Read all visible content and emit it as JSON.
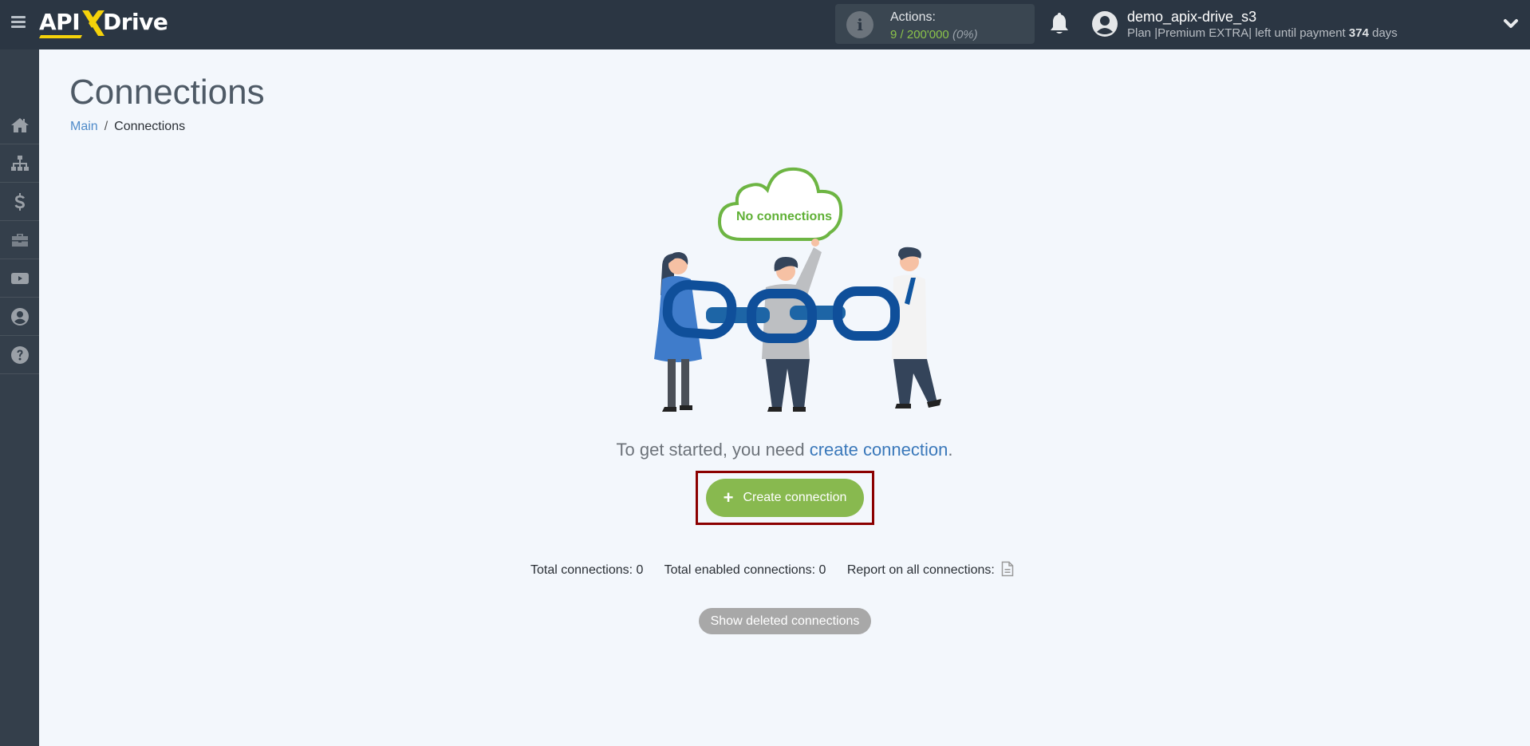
{
  "header": {
    "logo_left": "API",
    "logo_x": "X",
    "logo_right": "Drive",
    "actions_label": "Actions:",
    "actions_used": "9",
    "actions_sep": " / ",
    "actions_total": "200'000",
    "actions_percent": "(0%)",
    "username": "demo_apix-drive_s3",
    "plan_prefix": "Plan |Premium EXTRA| left until payment ",
    "plan_days": "374",
    "plan_suffix": " days",
    "icons": {
      "menu": "hamburger-menu-icon",
      "info": "info-icon",
      "bell": "bell-icon",
      "avatar": "user-avatar-icon",
      "chevron": "chevron-down-icon"
    }
  },
  "sidebar": {
    "items": [
      {
        "name": "home",
        "icon": "home-icon"
      },
      {
        "name": "connections",
        "icon": "sitemap-icon"
      },
      {
        "name": "billing",
        "icon": "dollar-icon"
      },
      {
        "name": "services",
        "icon": "briefcase-icon"
      },
      {
        "name": "video",
        "icon": "youtube-icon"
      },
      {
        "name": "account",
        "icon": "user-circle-icon"
      },
      {
        "name": "help",
        "icon": "question-circle-icon"
      }
    ]
  },
  "main": {
    "title": "Connections",
    "breadcrumb": {
      "home": "Main",
      "separator": "/",
      "current": "Connections"
    },
    "illustration": {
      "cloud_text": "No connections"
    },
    "get_started_prefix": "To get started, you need ",
    "get_started_link": "create connection",
    "get_started_suffix": ".",
    "create_button": {
      "icon": "+",
      "label": "Create connection"
    },
    "stats": {
      "total": "Total connections: 0",
      "enabled": "Total enabled connections: 0",
      "report": "Report on all connections:"
    },
    "show_deleted_label": "Show deleted connections"
  },
  "colors": {
    "header_bg": "#2b3643",
    "sidebar_bg": "#343f4b",
    "page_bg": "#f3f7fc",
    "accent_green": "#88b94f",
    "link_blue": "#3a78ba",
    "logo_yellow": "#f5d20a",
    "highlight_red": "#8b0000"
  }
}
